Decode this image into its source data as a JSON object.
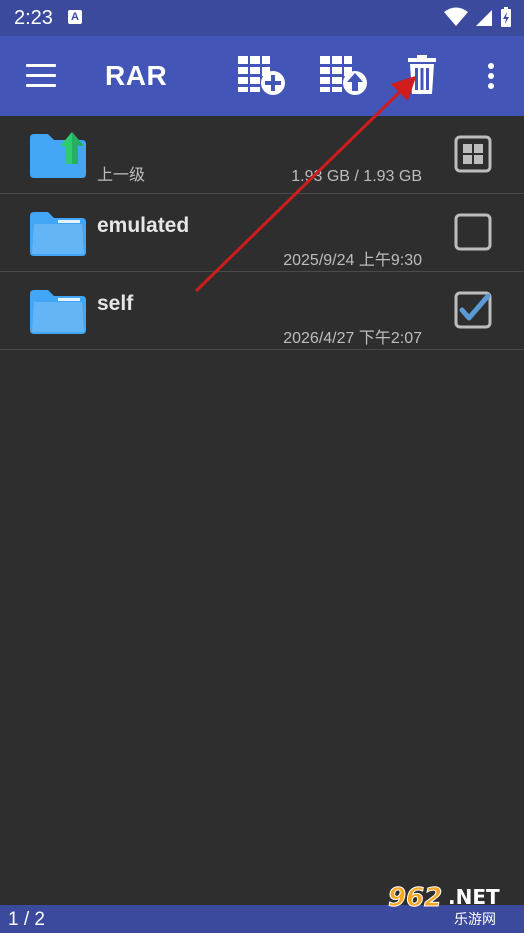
{
  "status": {
    "time": "2:23"
  },
  "toolbar": {
    "title": "RAR"
  },
  "rows": [
    {
      "name": "",
      "sub": "上一级",
      "meta": "1.93 GB / 1.93 GB"
    },
    {
      "name": "emulated",
      "sub": "",
      "meta": "2025/9/24 上午9:30"
    },
    {
      "name": "self",
      "sub": "",
      "meta": "2026/4/27 下午2:07"
    }
  ],
  "footer": {
    "count": "1 / 2"
  },
  "watermark": {
    "text": "962.NET",
    "sub": "乐游网"
  },
  "colors": {
    "accent": "#4355b7",
    "statusbar": "#3b4a9c",
    "folder": "#42a5f5",
    "check": "#5b9bd5",
    "arrow": "#d01c1c"
  }
}
